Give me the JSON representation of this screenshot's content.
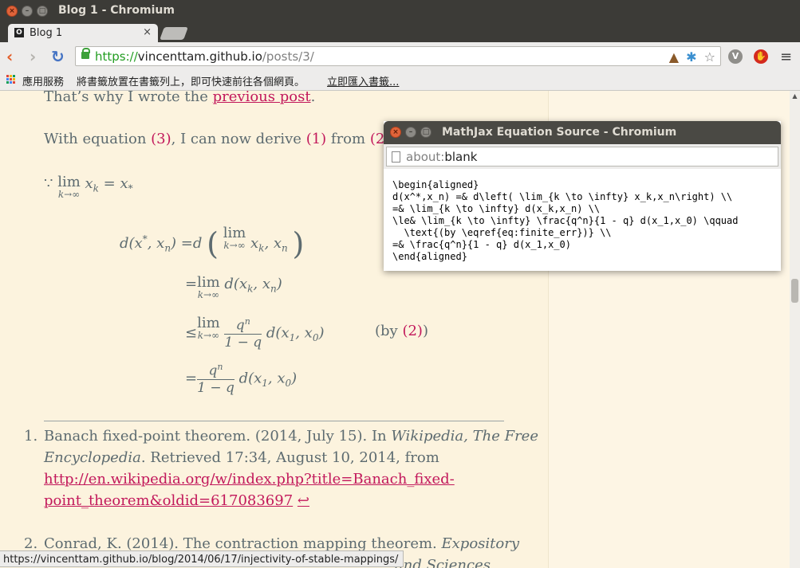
{
  "window": {
    "title": "Blog 1 - Chromium"
  },
  "tab": {
    "favicon": "O",
    "label": "Blog 1",
    "close": "×"
  },
  "toolbar": {
    "back": "‹",
    "forward": "›",
    "reload": "↻",
    "url_scheme": "https://",
    "url_host": "vincenttam.github.io",
    "url_path": "/posts/3/",
    "menu": "≡"
  },
  "bookmarks": {
    "apps_label": "應用服務",
    "hint": "將書籤放置在書籤列上，即可快速前往各個網頁。",
    "import_label": "立即匯入書籤..."
  },
  "content": {
    "para1_before": "That’s why I wrote the ",
    "para1_link": "previous post",
    "para1_after": ".",
    "para2_a": "With equation ",
    "para2_ref3": "(3)",
    "para2_b": ", I can now derive ",
    "para2_ref1": "(1)",
    "para2_c": " from ",
    "para2_ref2": "(2)",
    "para2_d": ".",
    "because": "∵",
    "lim": "lim",
    "lim_sub": "k→∞",
    "by_text_a": "(by ",
    "by_ref": "(2)",
    "by_text_b": ")",
    "footnotes": [
      {
        "num": "1.",
        "line1_a": "Banach fixed-point theorem. (2014, July 15). In ",
        "line1_i": "Wikipedia, The Free",
        "line2_i": "Encyclopedia",
        "line2_a": ". Retrieved 17:34, August 10, 2014, from",
        "link1": "http://en.wikipedia.org/w/index.php?title=Banach_fixed-",
        "link2": "point_theorem&oldid=617083697",
        "back": "↩"
      },
      {
        "num": "2.",
        "line1_a": "Conrad, K. (2014). The contraction mapping theorem. ",
        "line1_i": "Expository",
        "line2_i": "and Sciences"
      }
    ]
  },
  "status_url": "https://vincenttam.github.io/blog/2014/06/17/injectivity-of-stable-mappings/",
  "popup": {
    "title": "MathJax Equation Source - Chromium",
    "url_scheme": "about:",
    "url_rest": "blank",
    "code": "\\begin{aligned}\nd(x^*,x_n) =& d\\left( \\lim_{k \\to \\infty} x_k,x_n\\right) \\\\\n=& \\lim_{k \\to \\infty} d(x_k,x_n) \\\\\n\\le& \\lim_{k \\to \\infty} \\frac{q^n}{1 - q} d(x_1,x_0) \\qquad\n  \\text{(by \\eqref{eq:finite_err})} \\\\\n=& \\frac{q^n}{1 - q} d(x_1,x_0)\n\\end{aligned}"
  }
}
